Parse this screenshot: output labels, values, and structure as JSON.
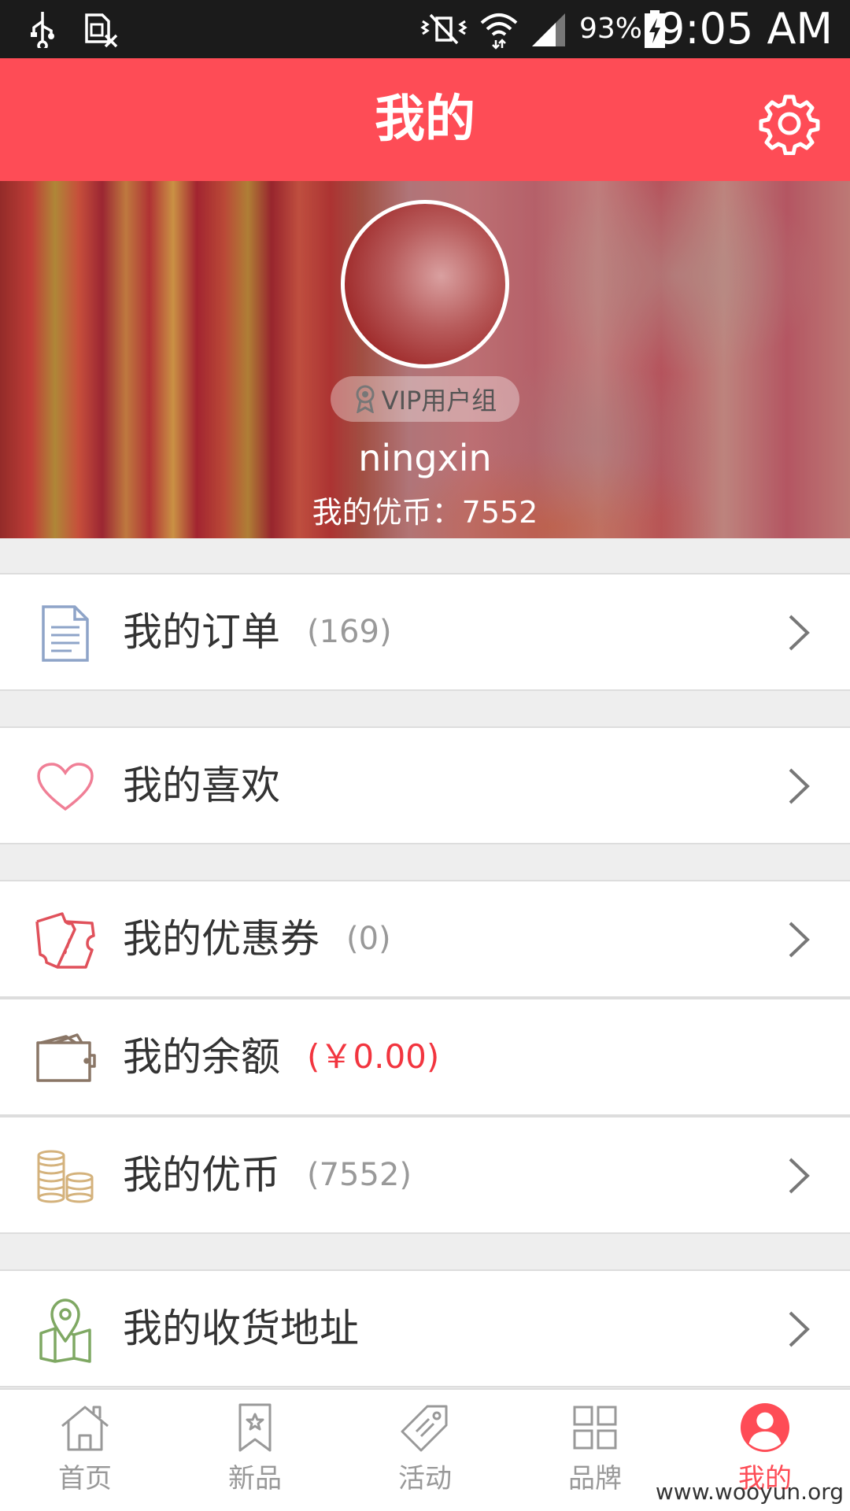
{
  "status_bar": {
    "battery_percent": "93%",
    "time": "9:05 AM"
  },
  "header": {
    "title": "我的",
    "settings_icon": "gear-icon"
  },
  "profile": {
    "vip_label": "VIP用户组",
    "username": "ningxin",
    "coins_text": "我的优币：7552"
  },
  "menu": {
    "orders": {
      "label": "我的订单",
      "count": "(169)",
      "icon": "document-icon"
    },
    "favorites": {
      "label": "我的喜欢",
      "icon": "heart-icon"
    },
    "coupons": {
      "label": "我的优惠券",
      "count": "(0)",
      "icon": "ticket-icon"
    },
    "balance": {
      "label": "我的余额",
      "amount": "(￥0.00)",
      "icon": "wallet-icon"
    },
    "coins": {
      "label": "我的优币",
      "count": "(7552)",
      "icon": "coins-icon"
    },
    "address": {
      "label": "我的收货地址",
      "icon": "map-pin-icon"
    }
  },
  "bottom_nav": {
    "items": [
      {
        "label": "首页",
        "icon": "home-icon"
      },
      {
        "label": "新品",
        "icon": "bookmark-icon"
      },
      {
        "label": "活动",
        "icon": "tag-icon"
      },
      {
        "label": "品牌",
        "icon": "grid-icon"
      },
      {
        "label": "我的",
        "icon": "user-icon",
        "active": true
      }
    ]
  },
  "watermark": "www.wooyun.org",
  "colors": {
    "brand": "#fe4c56",
    "price_red": "#f2353f"
  }
}
